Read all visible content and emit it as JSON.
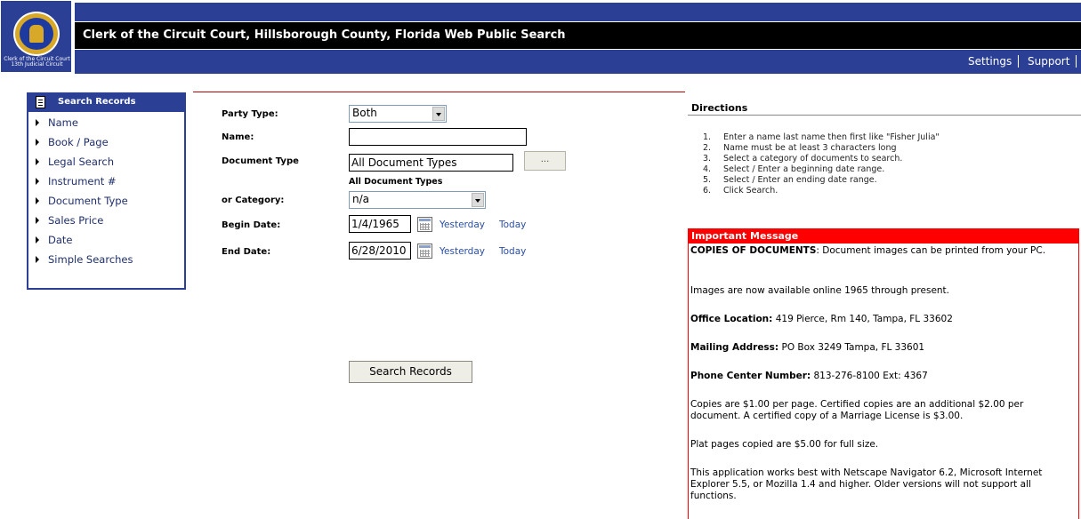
{
  "logo": {
    "caption_line1": "Clerk of the Circuit Court",
    "caption_line2": "13th Judicial Circuit",
    "icon": "county-seal-icon"
  },
  "header": {
    "title": "Clerk of the Circuit Court, Hillsborough County, Florida Web Public Search",
    "nav": [
      "Settings",
      "Support"
    ]
  },
  "sidebar": {
    "title": "Search Records",
    "icon": "document-icon",
    "items": [
      "Name",
      "Book / Page",
      "Legal Search",
      "Instrument #",
      "Document Type",
      "Sales Price",
      "Date",
      "Simple Searches"
    ]
  },
  "form": {
    "party_type_label": "Party Type:",
    "party_type_value": "Both",
    "name_label": "Name:",
    "name_value": "",
    "doc_type_label": "Document Type",
    "doc_type_value": "All Document Types",
    "doc_type_button": "...",
    "doc_type_sublabel": "All Document Types",
    "category_label": "or Category:",
    "category_value": "n/a",
    "begin_label": "Begin Date:",
    "begin_value": "1/4/1965",
    "end_label": "End Date:",
    "end_value": "6/28/2010",
    "yesterday": "Yesterday",
    "today": "Today",
    "search_button": "Search Records"
  },
  "directions": {
    "title": "Directions",
    "items": [
      {
        "num": "1.",
        "text": "Enter a name last name then first like \"Fisher Julia\""
      },
      {
        "num": "2.",
        "text": "Name must be at least 3 characters long"
      },
      {
        "num": "3.",
        "text": "Select a category of documents to search."
      },
      {
        "num": "4.",
        "text": "Select / Enter a beginning date range."
      },
      {
        "num": "5.",
        "text": "Select / Enter an ending date range."
      },
      {
        "num": "6.",
        "text": "Click Search."
      }
    ]
  },
  "message": {
    "title": "Important Message",
    "copies_label": "COPIES OF DOCUMENTS",
    "copies_text": ": Document images can be printed from your PC.",
    "images_text": "Images are now available online 1965 through present.",
    "office_label": "Office Location:",
    "office_text": "419 Pierce, Rm 140, Tampa, FL 33602",
    "mailing_label": "Mailing Address:",
    "mailing_text": "PO Box 3249 Tampa, FL 33601",
    "phone_label": "Phone Center Number:",
    "phone_text": "813-276-8100 Ext: 4367",
    "fees_text": "Copies are $1.00 per page. Certified copies are an additional $2.00 per document. A certified copy of a Marriage License is $3.00.",
    "plat_text": "Plat pages copied are $5.00 for full size.",
    "browser_text": "This application works best with Netscape Navigator 6.2, Microsoft Internet Explorer 5.5, or Mozilla 1.4 and higher. Older versions will not support all functions."
  },
  "colors": {
    "header_blue": "#2b3f95",
    "title_black": "#000000",
    "alert_red": "#ff0000",
    "link_blue": "#2b4ea0"
  }
}
